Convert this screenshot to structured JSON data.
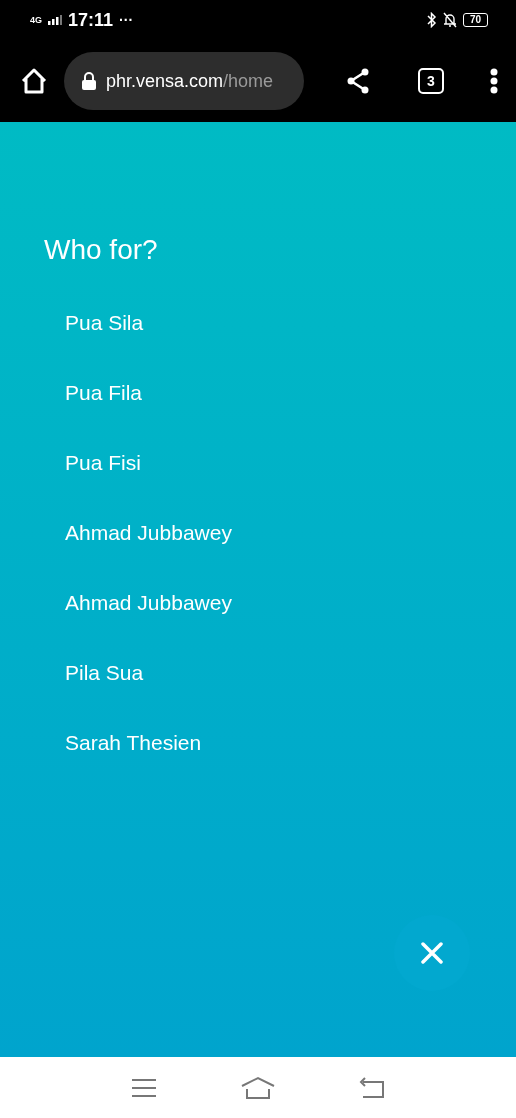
{
  "status_bar": {
    "network": "4G",
    "time": "17:11",
    "more": "···",
    "battery": "70"
  },
  "browser": {
    "url_host": "phr.vensa.com",
    "url_path": "/home",
    "tab_count": "3"
  },
  "title": "Who for?",
  "people": [
    "Pua Sila",
    "Pua Fila",
    "Pua Fisi",
    "Ahmad Jubbawey",
    "Ahmad Jubbawey",
    "Pila Sua",
    "Sarah Thesien"
  ]
}
